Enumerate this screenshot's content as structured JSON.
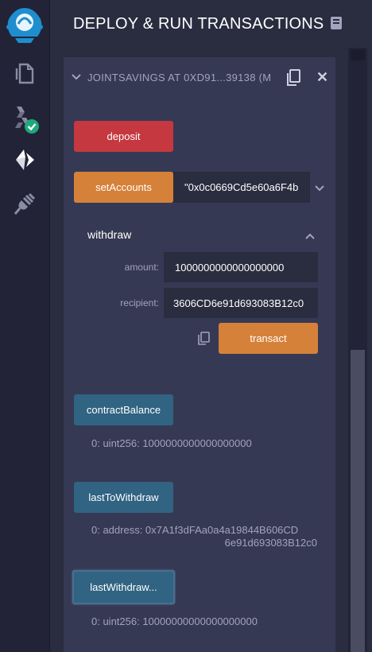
{
  "icon_bar": {
    "items": [
      "remix-logo-icon",
      "file-explorer-icon",
      "solidity-compiler-icon",
      "deploy-run-icon",
      "plugin-manager-icon"
    ]
  },
  "header": {
    "title": "DEPLOY & RUN TRANSACTIONS"
  },
  "instance": {
    "title": "JOINTSAVINGS AT 0XD91...39138 (M"
  },
  "deposit": {
    "label": "deposit"
  },
  "setAccounts": {
    "label": "setAccounts",
    "value": "\"0x0c0669Cd5e60a6F4b"
  },
  "withdraw": {
    "label": "withdraw",
    "amount_label": "amount:",
    "amount_value": "1000000000000000000",
    "recipient_label": "recipient:",
    "recipient_value": "3606CD6e91d693083B12c0",
    "transact_label": "transact"
  },
  "contractBalance": {
    "label": "contractBalance",
    "result": "0: uint256: 1000000000000000000"
  },
  "lastToWithdraw": {
    "label": "lastToWithdraw",
    "result_line1": "0: address: 0x7A1f3dFAa0a4a19844B606CD",
    "result_line2": "6e91d693083B12c0"
  },
  "lastWithdraw": {
    "label": "lastWithdraw...",
    "result": "0: uint256: 10000000000000000000"
  },
  "colors": {
    "red": "#c5383f",
    "orange": "#d6813a",
    "blue": "#316382",
    "panel": "#363953",
    "accent_green": "#1ea97c"
  }
}
